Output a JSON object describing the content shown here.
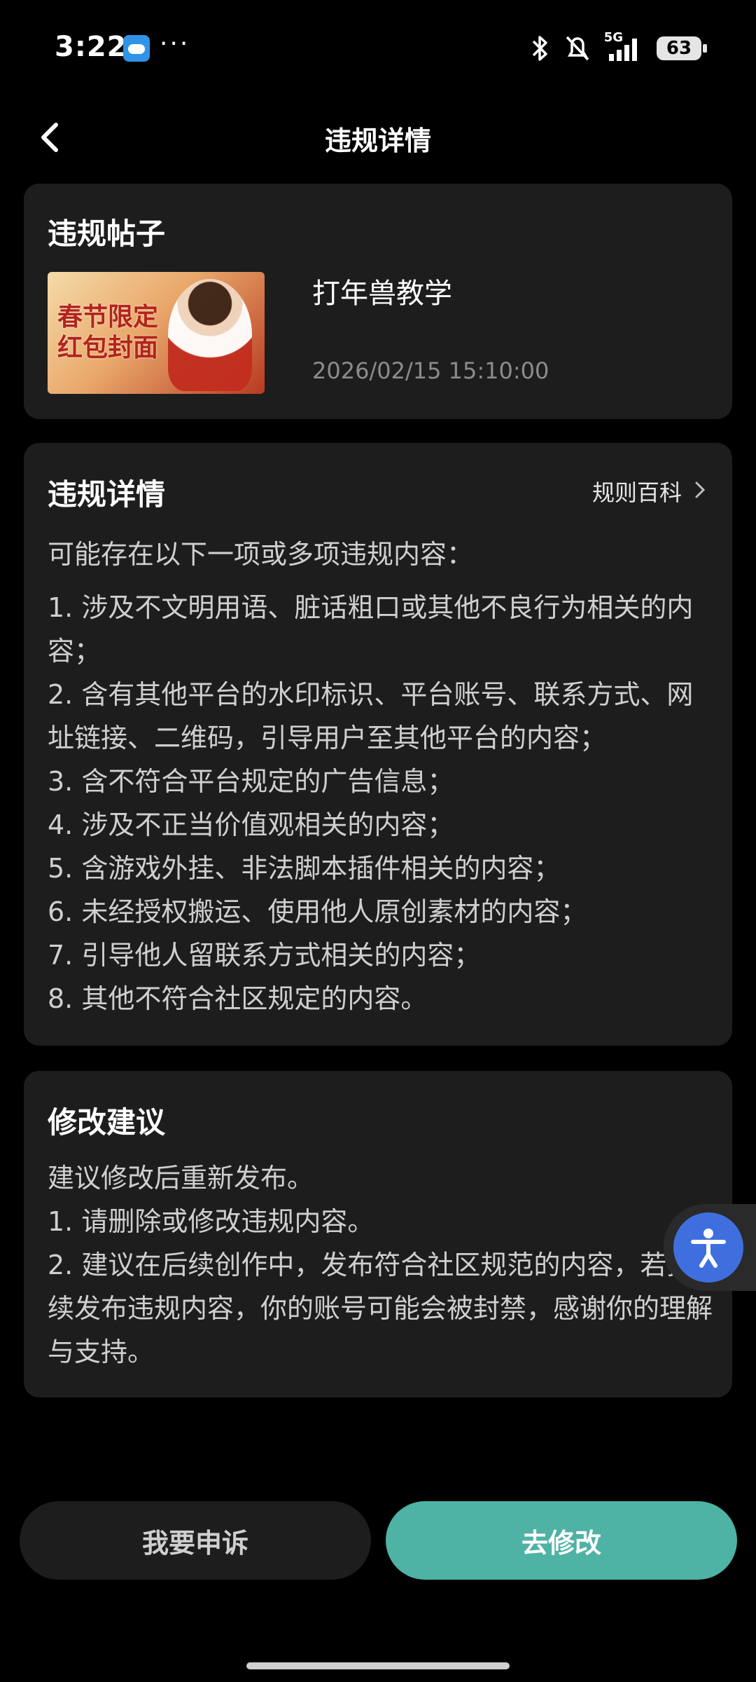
{
  "status_bar": {
    "time": "3:22",
    "dots": "···",
    "network": "5G",
    "battery": "63"
  },
  "header": {
    "title": "违规详情"
  },
  "post_card": {
    "section_title": "违规帖子",
    "post_title": "打年兽教学",
    "post_date": "2026/02/15 15:10:00",
    "thumbnail_text_line1": "春节限定",
    "thumbnail_text_line2": "红包封面"
  },
  "detail_card": {
    "section_title": "违规详情",
    "rules_link": "规则百科",
    "intro": "可能存在以下一项或多项违规内容：",
    "items": [
      "1. 涉及不文明用语、脏话粗口或其他不良行为相关的内容；",
      "2. 含有其他平台的水印标识、平台账号、联系方式、网址链接、二维码，引导用户至其他平台的内容；",
      "3. 含不符合平台规定的广告信息；",
      "4. 涉及不正当价值观相关的内容；",
      "5. 含游戏外挂、非法脚本插件相关的内容；",
      "6. 未经授权搬运、使用他人原创素材的内容；",
      "7. 引导他人留联系方式相关的内容；",
      "8. 其他不符合社区规定的内容。"
    ]
  },
  "advice_card": {
    "section_title": "修改建议",
    "lines": [
      "建议修改后重新发布。",
      "1. 请删除或修改违规内容。",
      "2. 建议在后续创作中，发布符合社区规范的内容，若持续发布违规内容，你的账号可能会被封禁，感谢你的理解与支持。"
    ]
  },
  "actions": {
    "appeal_label": "我要申诉",
    "edit_label": "去修改"
  },
  "colors": {
    "accent": "#4eb2a4",
    "card_bg": "#1d1d1d",
    "a11y_blue": "#3f6fde"
  }
}
